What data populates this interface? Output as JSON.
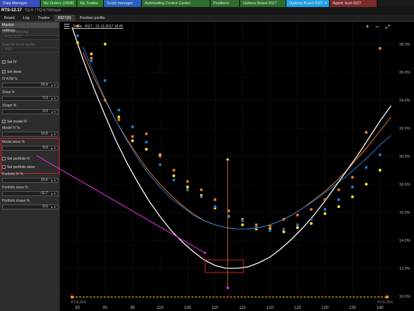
{
  "top_tabs": [
    {
      "label": "Data Manager",
      "color": "#3b4bc2"
    },
    {
      "label": "My Orders (2858)",
      "color": "#2a7a2a"
    },
    {
      "label": "My Trades",
      "color": "#2a7a2a"
    },
    {
      "label": "Script manager",
      "color": "#2a5fc0"
    },
    {
      "label": "Autotrading Control Center",
      "color": "#2e6e2e"
    },
    {
      "label": "Positions",
      "color": "#2e6e2e"
    },
    {
      "label": "Options Board RIZ7",
      "color": "#2e6e2e"
    },
    {
      "label": "Options Board RIZ7",
      "color": "#1fa0e6",
      "active": true
    },
    {
      "label": "Agent: kuvi-SIZ7",
      "color": "#7a2a2a"
    }
  ],
  "title_main": "RTS-12.17",
  "title_sub": "TQ-K / TQ-K7680apk",
  "sub_tabs": [
    "Board",
    "Log",
    "Trades",
    "RIZ7(0)",
    "Position profile"
  ],
  "active_sub_tab": 3,
  "panel": {
    "title": "Market settings",
    "field_dim_1_label": "Ba se underlying",
    "field_dim_1_value": "RTS 12.17",
    "field_dim_2_label": "Base for ba se quote",
    "field_dim_2_value": "RIZ7",
    "set_iv": "Set IV",
    "set_skew": "Set skew",
    "iv_atm_label": "IV ATM %",
    "iv_atm_value": "15.3",
    "skew_label": "Skew %",
    "skew_value": "-7.0",
    "shape_label": "Shape %",
    "shape_value": "0.0",
    "set_model_iv": "Set model IV",
    "model_iv_label": "Model IV %",
    "model_iv_value": "12.0",
    "model_skew_label": "Model skew %",
    "model_skew_value": "0.0",
    "set_portfolio_iv": "Set portfolio IV",
    "set_portfolio_skew": "Set portfolio skew",
    "portfolio_iv_label": "Portfolio IV %",
    "portfolio_iv_value": "15.6",
    "portfolio_skew_label": "Portfolio skew %",
    "portfolio_skew_value": "-11.7",
    "portfolio_shape_label": "Portfolio shape %",
    "portfolio_shape_value": "0.0"
  },
  "chart_toolbar": {
    "title": "Smile - RIZ7 - 21-11-2017 18:45",
    "plus": "+",
    "minus": "−",
    "expand": "⤢"
  },
  "chart_data": {
    "type": "scatter",
    "xlim": [
      82.5,
      143
    ],
    "ylim": [
      9.7,
      29.5
    ],
    "x_ticks": [
      85,
      90,
      95,
      100,
      105,
      110,
      115,
      120,
      125,
      130,
      135,
      140
    ],
    "y_ticks": [
      10.0,
      12.0,
      14.0,
      16.0,
      18.0,
      20.0,
      22.0,
      24.0,
      26.0,
      28.0
    ],
    "y_tick_labels": [
      "10.0%",
      "12.0%",
      "14.0%",
      "16.0%",
      "18.0%",
      "20.0%",
      "22.0%",
      "24.0%",
      "26.0%",
      "28.0%"
    ],
    "hv_left_label": "HV:8.25%",
    "hv_right_label": "HV:8.25%",
    "hv_line_y": 9.95,
    "atm_x": 112.3,
    "atm_arrow_top": 19.9,
    "atm_arrow_bottom": 10.6,
    "marker_top_label": "",
    "highlight_box": {
      "x0": 108.2,
      "x1": 115.2,
      "y0": 11.7,
      "y1": 12.6
    },
    "pointer_line": {
      "from": [
        86,
        28.5
      ],
      "to": [
        109,
        11.9
      ]
    },
    "model_curve_white": {
      "x": [
        84,
        86,
        88,
        90,
        92,
        94,
        96,
        98,
        100,
        102,
        104,
        106,
        108,
        110,
        112,
        114,
        116,
        118,
        120,
        122,
        124,
        126,
        128,
        130,
        132,
        134,
        136,
        138,
        140,
        142
      ],
      "y": [
        29.2,
        26.9,
        24.8,
        22.9,
        21.1,
        19.5,
        18.1,
        16.8,
        15.7,
        14.7,
        13.9,
        13.2,
        12.6,
        12.2,
        12.0,
        12.0,
        12.1,
        12.4,
        12.8,
        13.4,
        14.1,
        14.9,
        15.8,
        16.8,
        17.9,
        19.0,
        20.1,
        21.3,
        22.5,
        23.6
      ]
    },
    "series": [
      {
        "name": "",
        "color": "#e8792b",
        "kind": "curve",
        "x": [
          86,
          88,
          90,
          92,
          94,
          96,
          98,
          100,
          102,
          104,
          106,
          108,
          110,
          112,
          114,
          116,
          118,
          120,
          122,
          124,
          126,
          128,
          130,
          132,
          134,
          136,
          138,
          140,
          142
        ],
        "y": [
          27.4,
          25.6,
          24.0,
          22.5,
          21.2,
          20.0,
          18.9,
          18.0,
          17.2,
          16.5,
          15.9,
          15.4,
          15.1,
          14.9,
          14.8,
          14.8,
          14.9,
          15.1,
          15.4,
          15.8,
          16.3,
          16.9,
          17.5,
          18.2,
          19.0,
          19.9,
          20.8,
          21.8,
          22.8
        ]
      },
      {
        "name": "",
        "color": "#2b78c8",
        "kind": "curve",
        "x": [
          86,
          88,
          90,
          92,
          94,
          96,
          98,
          100,
          102,
          104,
          106,
          108,
          110,
          112,
          114,
          116,
          118,
          120,
          122,
          124,
          126,
          128,
          130,
          132,
          134,
          136,
          138,
          140,
          142
        ],
        "y": [
          27.8,
          25.9,
          24.1,
          22.5,
          21.1,
          19.8,
          18.7,
          17.8,
          17.0,
          16.4,
          15.8,
          15.4,
          15.1,
          14.9,
          14.8,
          14.8,
          14.9,
          15.1,
          15.4,
          15.8,
          16.3,
          16.8,
          17.4,
          18.0,
          18.6,
          19.3,
          20.0,
          20.8,
          21.5
        ]
      },
      {
        "name": "",
        "color": "#f2e01b",
        "kind": "points",
        "x": [
          85,
          87.5,
          90,
          92.5,
          95,
          97.5,
          100,
          102.5,
          105,
          107.5,
          110,
          112.5,
          115,
          117.5,
          120,
          122.5,
          125,
          127.5,
          130,
          132.5,
          135,
          137.5,
          140
        ],
        "y": [
          28.1,
          27.3,
          28.0,
          22.8,
          21.1,
          20.5,
          20.1,
          18.6,
          17.8,
          17.2,
          16.3,
          15.7,
          15.1,
          14.8,
          14.8,
          14.6,
          14.9,
          15.2,
          15.9,
          16.4,
          17.1,
          18.0,
          19.0
        ]
      },
      {
        "name": "",
        "color": "#e8792b",
        "kind": "points",
        "x": [
          85,
          87.5,
          90,
          92.5,
          95,
          97.5,
          100,
          102.5,
          105,
          107.5,
          110,
          112.5,
          115,
          117.5,
          120,
          122.5,
          125,
          127.5,
          130,
          132.5,
          135,
          137.5,
          140
        ],
        "y": [
          29.3,
          27.0,
          24.0,
          22.6,
          21.4,
          21.6,
          20.0,
          19.0,
          18.2,
          17.6,
          16.9,
          16.1,
          15.5,
          15.1,
          15.0,
          15.5,
          15.8,
          16.2,
          16.9,
          17.6,
          18.5,
          21.7,
          27.7
        ]
      },
      {
        "name": "",
        "color": "#2b78c8",
        "kind": "points",
        "x": [
          85,
          87.5,
          90,
          92.5,
          95,
          97.5,
          100,
          102.5,
          105,
          107.5,
          110,
          112.5,
          115,
          117.5,
          120,
          122.5,
          125,
          127.5,
          130,
          132.5,
          135,
          137.5,
          140
        ],
        "y": [
          28.6,
          26.8,
          25.4,
          23.3,
          22.1,
          21.0,
          19.4,
          18.3,
          17.6,
          17.1,
          16.4,
          15.7,
          15.4,
          14.9,
          14.7,
          14.8,
          15.1,
          15.5,
          16.2,
          16.9,
          17.8,
          19.2,
          20.1
        ]
      }
    ]
  }
}
